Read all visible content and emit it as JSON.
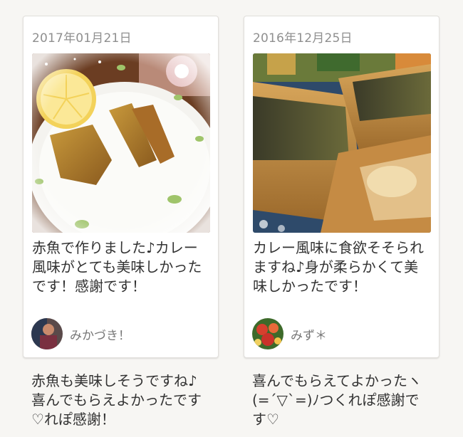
{
  "cards": [
    {
      "date": "2017年01月21日",
      "comment": "赤魚で作りました♪カレー風味がとても美味しかったです！感謝です！",
      "author": "みかづき！",
      "reply": "赤魚も美味しそうですね♪喜んでもらえよかったです♡れぽ感謝！",
      "photo_icon": "fried-fish-plate-photo",
      "avatar_icon": "user-avatar-photo"
    },
    {
      "date": "2016年12月25日",
      "comment": "カレー風味に食欲そそられますね♪身が柔らかくて美味しかったです！",
      "author": "みず＊",
      "reply": "喜んでもらえてよかったヽ(=´▽`=)ﾉつくれぽ感謝です♡",
      "photo_icon": "fried-fish-closeup-photo",
      "avatar_icon": "flower-avatar-photo"
    }
  ],
  "colors": {
    "background": "#f7f6f3",
    "card": "#ffffff",
    "text": "#333333",
    "muted": "#8f8f8f"
  }
}
